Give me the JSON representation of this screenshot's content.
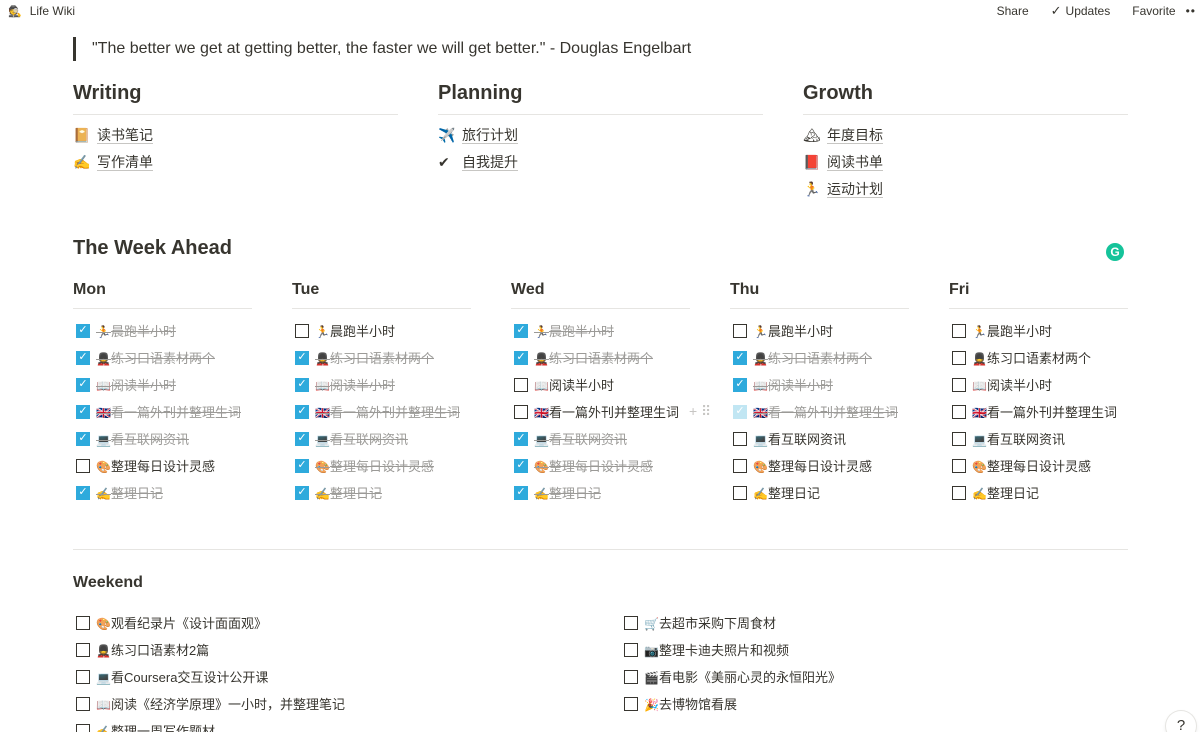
{
  "topbar": {
    "title": "Life Wiki",
    "share": "Share",
    "updates": "Updates",
    "favorite": "Favorite",
    "more": "••"
  },
  "quote": "\"The better we get at getting better, the faster we will get better.\" - Douglas Engelbart",
  "sections": [
    {
      "title": "Writing",
      "links": [
        {
          "icon": "📔",
          "text": "读书笔记"
        },
        {
          "icon": "✍️",
          "text": "写作清单"
        }
      ]
    },
    {
      "title": "Planning",
      "links": [
        {
          "icon": "✈️",
          "text": "旅行计划"
        },
        {
          "icon": "✔",
          "text": "自我提升"
        }
      ]
    },
    {
      "title": "Growth",
      "links": [
        {
          "icon": "🏔",
          "text": "年度目标"
        },
        {
          "icon": "📕",
          "text": "阅读书单"
        },
        {
          "icon": "🏃",
          "text": "运动计划"
        }
      ]
    }
  ],
  "week_title": "The Week Ahead",
  "grammarly": "G",
  "days": [
    {
      "name": "Mon",
      "tasks": [
        {
          "emoji": "🏃",
          "text": "晨跑半小时",
          "done": true
        },
        {
          "emoji": "💂",
          "text": "练习口语素材两个",
          "done": true
        },
        {
          "emoji": "📖",
          "text": "阅读半小时",
          "done": true
        },
        {
          "emoji": "🇬🇧",
          "text": "看一篇外刊并整理生词",
          "done": true
        },
        {
          "emoji": "💻",
          "text": "看互联网资讯",
          "done": true
        },
        {
          "emoji": "🎨",
          "text": "整理每日设计灵感",
          "done": false
        },
        {
          "emoji": "✍️",
          "text": "整理日记",
          "done": true
        }
      ]
    },
    {
      "name": "Tue",
      "tasks": [
        {
          "emoji": "🏃",
          "text": "晨跑半小时",
          "done": false
        },
        {
          "emoji": "💂",
          "text": "练习口语素材两个",
          "done": true
        },
        {
          "emoji": "📖",
          "text": "阅读半小时",
          "done": true
        },
        {
          "emoji": "🇬🇧",
          "text": "看一篇外刊并整理生词",
          "done": true
        },
        {
          "emoji": "💻",
          "text": "看互联网资讯",
          "done": true
        },
        {
          "emoji": "🎨",
          "text": "整理每日设计灵感",
          "done": true
        },
        {
          "emoji": "✍️",
          "text": "整理日记",
          "done": true
        }
      ]
    },
    {
      "name": "Wed",
      "tasks": [
        {
          "emoji": "🏃",
          "text": "晨跑半小时",
          "done": true
        },
        {
          "emoji": "💂",
          "text": "练习口语素材两个",
          "done": true
        },
        {
          "emoji": "📖",
          "text": "阅读半小时",
          "done": false
        },
        {
          "emoji": "🇬🇧",
          "text": "看一篇外刊并整理生词",
          "done": false,
          "handle": "+ ⠿"
        },
        {
          "emoji": "💻",
          "text": "看互联网资讯",
          "done": true
        },
        {
          "emoji": "🎨",
          "text": "整理每日设计灵感",
          "done": true
        },
        {
          "emoji": "✍️",
          "text": "整理日记",
          "done": true
        }
      ]
    },
    {
      "name": "Thu",
      "tasks": [
        {
          "emoji": "🏃",
          "text": "晨跑半小时",
          "done": false
        },
        {
          "emoji": "💂",
          "text": "练习口语素材两个",
          "done": true
        },
        {
          "emoji": "📖",
          "text": "阅读半小时",
          "done": true
        },
        {
          "emoji": "🇬🇧",
          "text": "看一篇外刊并整理生词",
          "done": true,
          "faded": true
        },
        {
          "emoji": "💻",
          "text": "看互联网资讯",
          "done": false
        },
        {
          "emoji": "🎨",
          "text": "整理每日设计灵感",
          "done": false
        },
        {
          "emoji": "✍️",
          "text": "整理日记",
          "done": false
        }
      ]
    },
    {
      "name": "Fri",
      "tasks": [
        {
          "emoji": "🏃",
          "text": "晨跑半小时",
          "done": false
        },
        {
          "emoji": "💂",
          "text": "练习口语素材两个",
          "done": false
        },
        {
          "emoji": "📖",
          "text": "阅读半小时",
          "done": false
        },
        {
          "emoji": "🇬🇧",
          "text": "看一篇外刊并整理生词",
          "done": false
        },
        {
          "emoji": "💻",
          "text": "看互联网资讯",
          "done": false
        },
        {
          "emoji": "🎨",
          "text": "整理每日设计灵感",
          "done": false
        },
        {
          "emoji": "✍️",
          "text": "整理日记",
          "done": false
        }
      ]
    }
  ],
  "weekend_title": "Weekend",
  "weekend_left": [
    {
      "emoji": "🎨",
      "text": "观看纪录片《设计面面观》",
      "done": false
    },
    {
      "emoji": "💂",
      "text": "练习口语素材2篇",
      "done": false
    },
    {
      "emoji": "💻",
      "text": "看Coursera交互设计公开课",
      "done": false
    },
    {
      "emoji": "📖",
      "text": "阅读《经济学原理》一小时，并整理笔记",
      "done": false
    },
    {
      "emoji": "✍️",
      "text": "整理一周写作题材",
      "done": false
    }
  ],
  "weekend_right": [
    {
      "emoji": "🛒",
      "text": "去超市采购下周食材",
      "done": false
    },
    {
      "emoji": "📷",
      "text": "整理卡迪夫照片和视频",
      "done": false
    },
    {
      "emoji": "🎬",
      "text": "看电影《美丽心灵的永恒阳光》",
      "done": false
    },
    {
      "emoji": "🎉",
      "text": "去博物馆看展",
      "done": false
    }
  ],
  "help": "?"
}
